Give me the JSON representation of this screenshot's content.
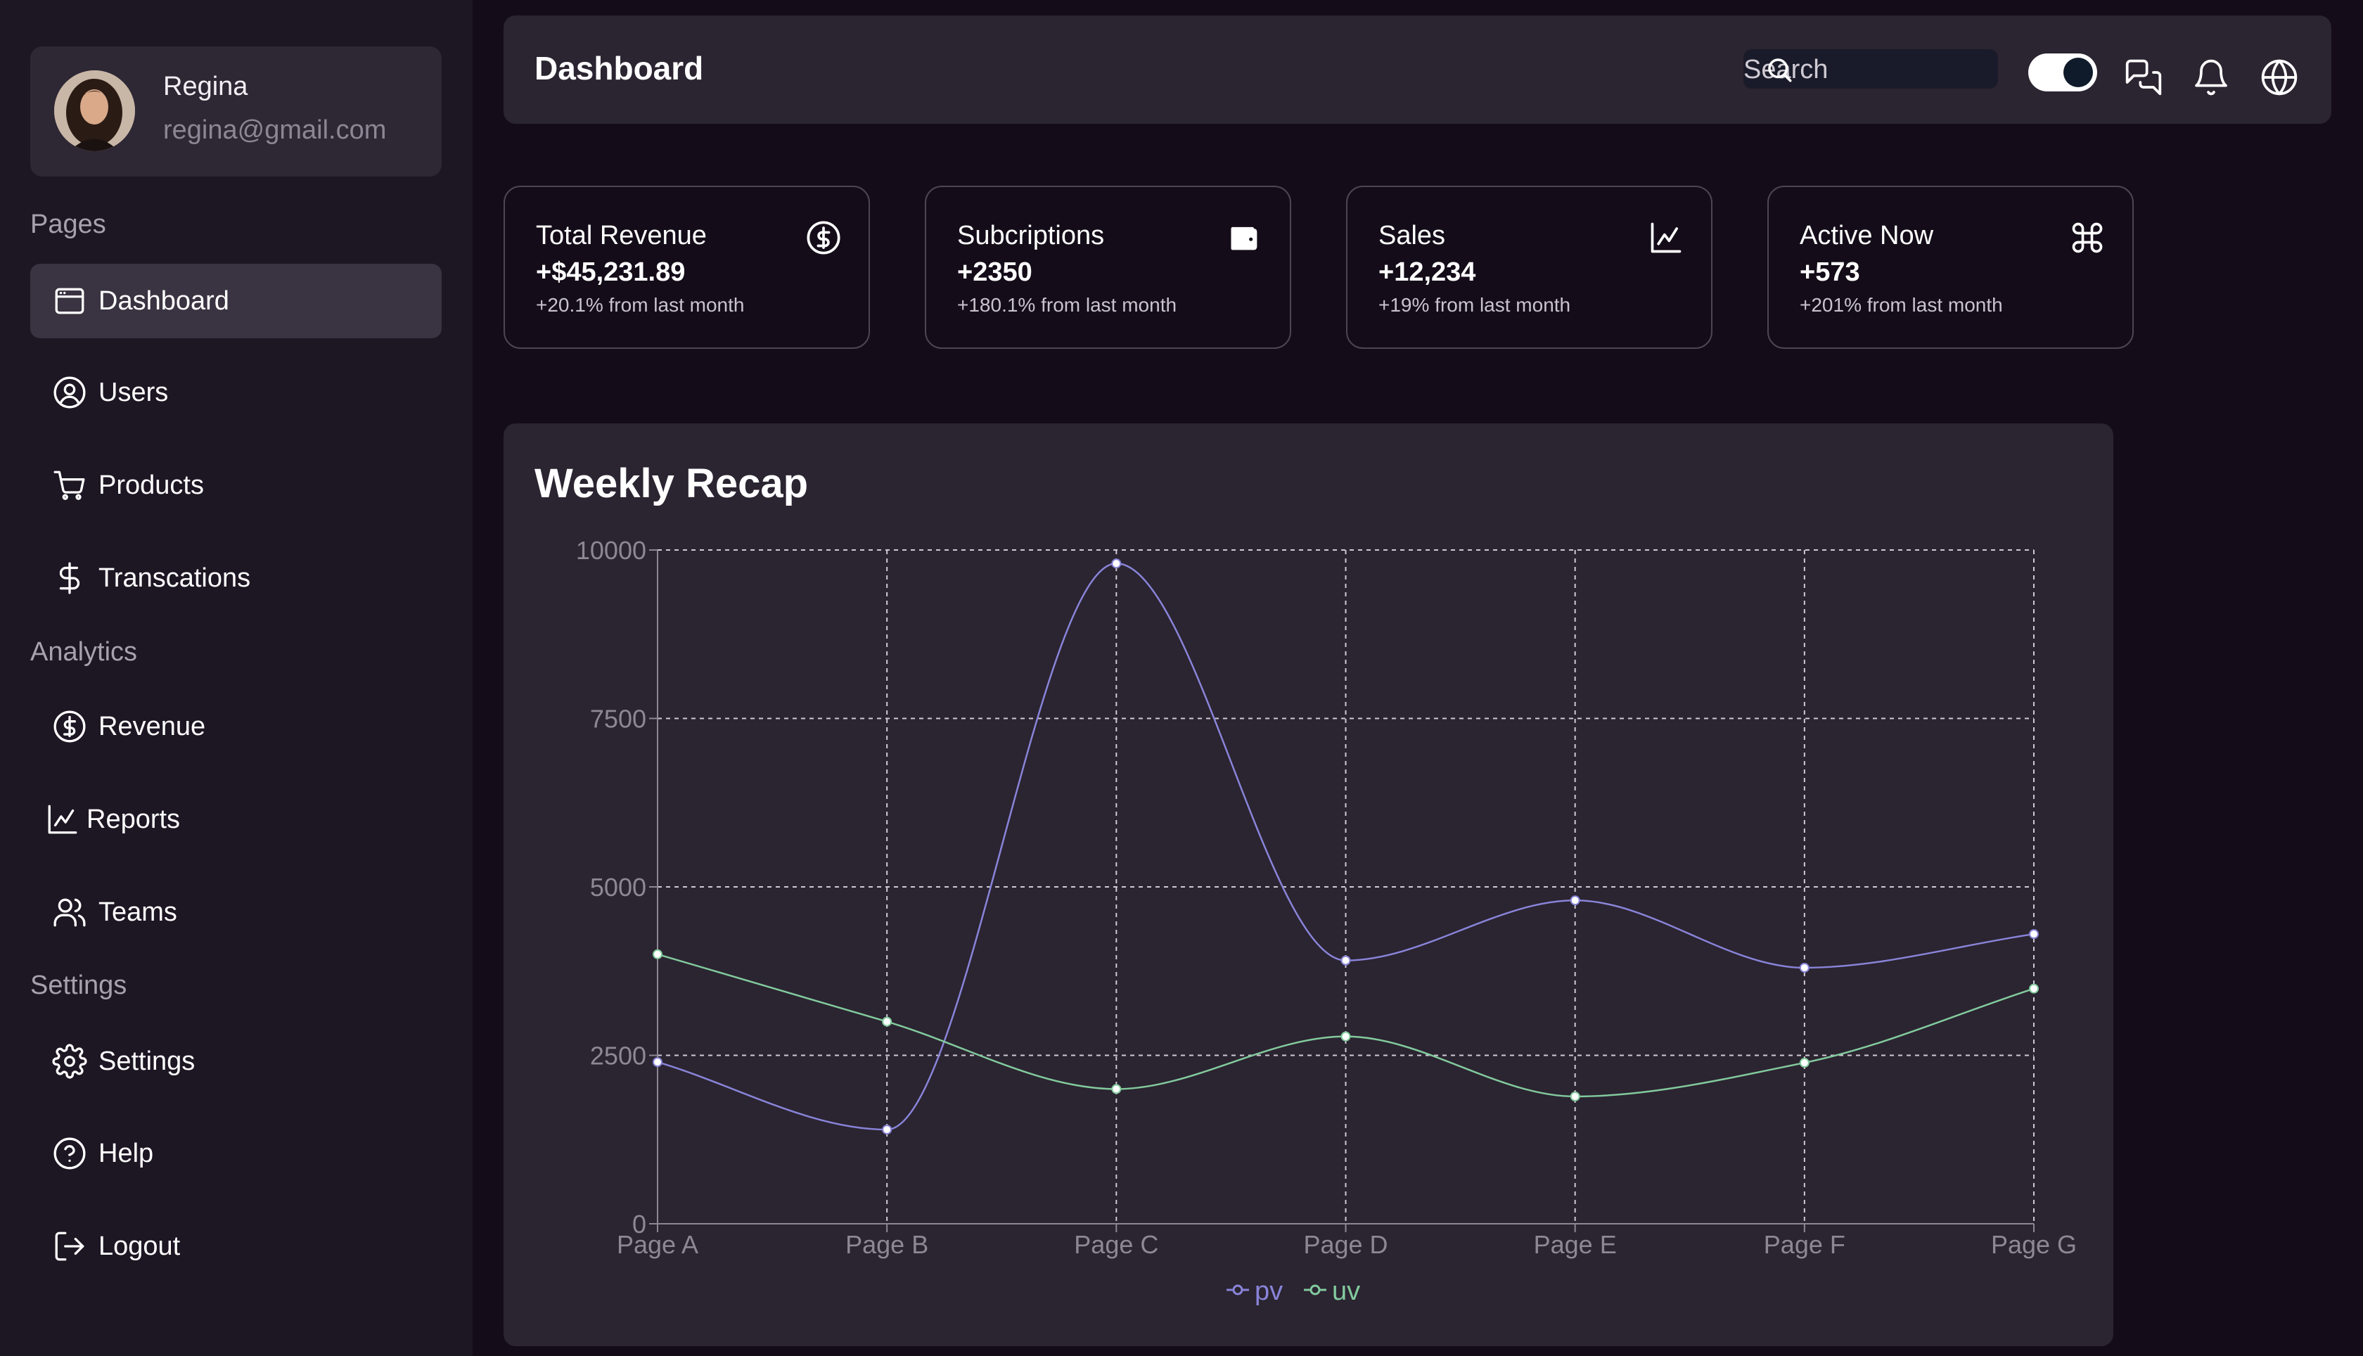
{
  "profile": {
    "name": "Regina",
    "email": "regina@gmail.com"
  },
  "sidebar": {
    "sections": [
      {
        "label": "Pages"
      },
      {
        "label": "Analytics"
      },
      {
        "label": "Settings"
      }
    ],
    "items": [
      {
        "label": "Dashboard",
        "icon": "browser-window-icon",
        "active": true
      },
      {
        "label": "Users",
        "icon": "user-circle-icon"
      },
      {
        "label": "Products",
        "icon": "shopping-cart-icon"
      },
      {
        "label": "Transcations",
        "icon": "dollar-sign-icon"
      },
      {
        "label": "Revenue",
        "icon": "dollar-circle-icon"
      },
      {
        "label": "Reports",
        "icon": "line-chart-icon"
      },
      {
        "label": "Teams",
        "icon": "users-icon"
      },
      {
        "label": "Settings",
        "icon": "gear-icon"
      },
      {
        "label": "Help",
        "icon": "help-circle-icon"
      },
      {
        "label": "Logout",
        "icon": "logout-icon"
      }
    ]
  },
  "header": {
    "title": "Dashboard",
    "search_placeholder": "Search",
    "theme_toggle_on": true,
    "icons": [
      "messages-icon",
      "bell-icon",
      "globe-icon"
    ]
  },
  "stats": [
    {
      "title": "Total Revenue",
      "value": "+$45,231.89",
      "sub": "+20.1% from last month",
      "icon": "dollar-circle-icon"
    },
    {
      "title": "Subcriptions",
      "value": "+2350",
      "sub": "+180.1% from last month",
      "icon": "wallet-icon"
    },
    {
      "title": "Sales",
      "value": "+12,234",
      "sub": "+19% from last month",
      "icon": "line-chart-icon"
    },
    {
      "title": "Active Now",
      "value": "+573",
      "sub": "+201% from last month",
      "icon": "command-icon"
    }
  ],
  "chart_title": "Weekly Recap",
  "chart_data": {
    "type": "line",
    "x": [
      "Page A",
      "Page B",
      "Page C",
      "Page D",
      "Page E",
      "Page F",
      "Page G"
    ],
    "series": [
      {
        "name": "pv",
        "values": [
          2400,
          1398,
          9800,
          3908,
          4800,
          3800,
          4300
        ],
        "color": "#8884d8"
      },
      {
        "name": "uv",
        "values": [
          4000,
          3000,
          2000,
          2780,
          1890,
          2390,
          3490
        ],
        "color": "#82ca9d"
      }
    ],
    "yticks": [
      0,
      2500,
      5000,
      7500,
      10000
    ],
    "ylim": [
      0,
      10000
    ],
    "grid": true,
    "legend": "bottom-center",
    "curve": "monotone"
  }
}
